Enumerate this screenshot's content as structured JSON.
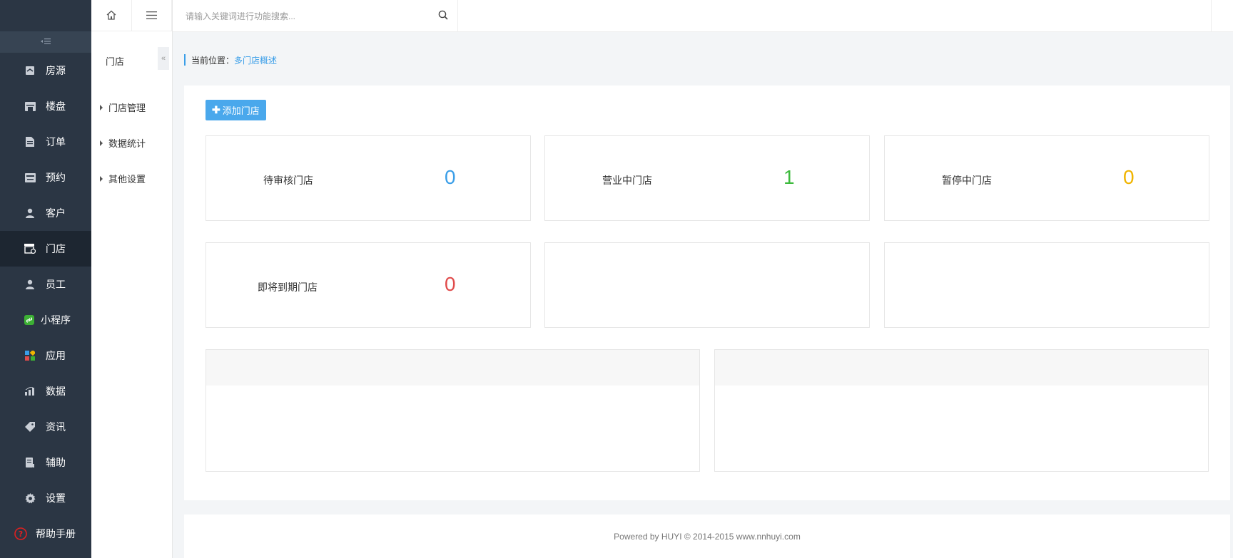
{
  "sidebar": {
    "items": [
      {
        "label": "房源",
        "icon": "house-icon"
      },
      {
        "label": "楼盘",
        "icon": "building-icon"
      },
      {
        "label": "订单",
        "icon": "document-icon"
      },
      {
        "label": "预约",
        "icon": "calendar-icon"
      },
      {
        "label": "客户",
        "icon": "user-icon"
      },
      {
        "label": "门店",
        "icon": "store-icon",
        "active": true
      },
      {
        "label": "员工",
        "icon": "user-icon"
      },
      {
        "label": "小程序",
        "icon": "miniprogram-icon"
      },
      {
        "label": "应用",
        "icon": "apps-icon"
      },
      {
        "label": "数据",
        "icon": "bar-chart-icon"
      },
      {
        "label": "资讯",
        "icon": "tag-icon"
      },
      {
        "label": "辅助",
        "icon": "book-icon"
      },
      {
        "label": "设置",
        "icon": "gear-icon"
      }
    ],
    "help": {
      "label": "帮助手册",
      "icon": "help-circle-icon",
      "color": "#e02020"
    },
    "collapse_icon": "collapse-icon"
  },
  "subnav": {
    "title": "门店",
    "items": [
      {
        "label": "门店管理"
      },
      {
        "label": "数据统计"
      },
      {
        "label": "其他设置"
      }
    ]
  },
  "topbar": {
    "search_placeholder": "请输入关键词进行功能搜索..."
  },
  "breadcrumb": {
    "prefix": "当前位置：",
    "current": "多门店概述"
  },
  "main": {
    "add_button": "添加门店",
    "stats": [
      {
        "label": "待审核门店",
        "value": "0",
        "color": "#3a9ee8"
      },
      {
        "label": "营业中门店",
        "value": "1",
        "color": "#3cba3c"
      },
      {
        "label": "暂停中门店",
        "value": "0",
        "color": "#f0b400"
      },
      {
        "label": "即将到期门店",
        "value": "0",
        "color": "#e04b4b"
      }
    ]
  },
  "footer": {
    "text": "Powered by HUYI © 2014-2015 www.nnhuyi.com"
  },
  "colors": {
    "sidebar_bg": "#2b3644",
    "sidebar_active": "#1d2631",
    "accent": "#3a9ee8",
    "button": "#4aa8ec"
  }
}
